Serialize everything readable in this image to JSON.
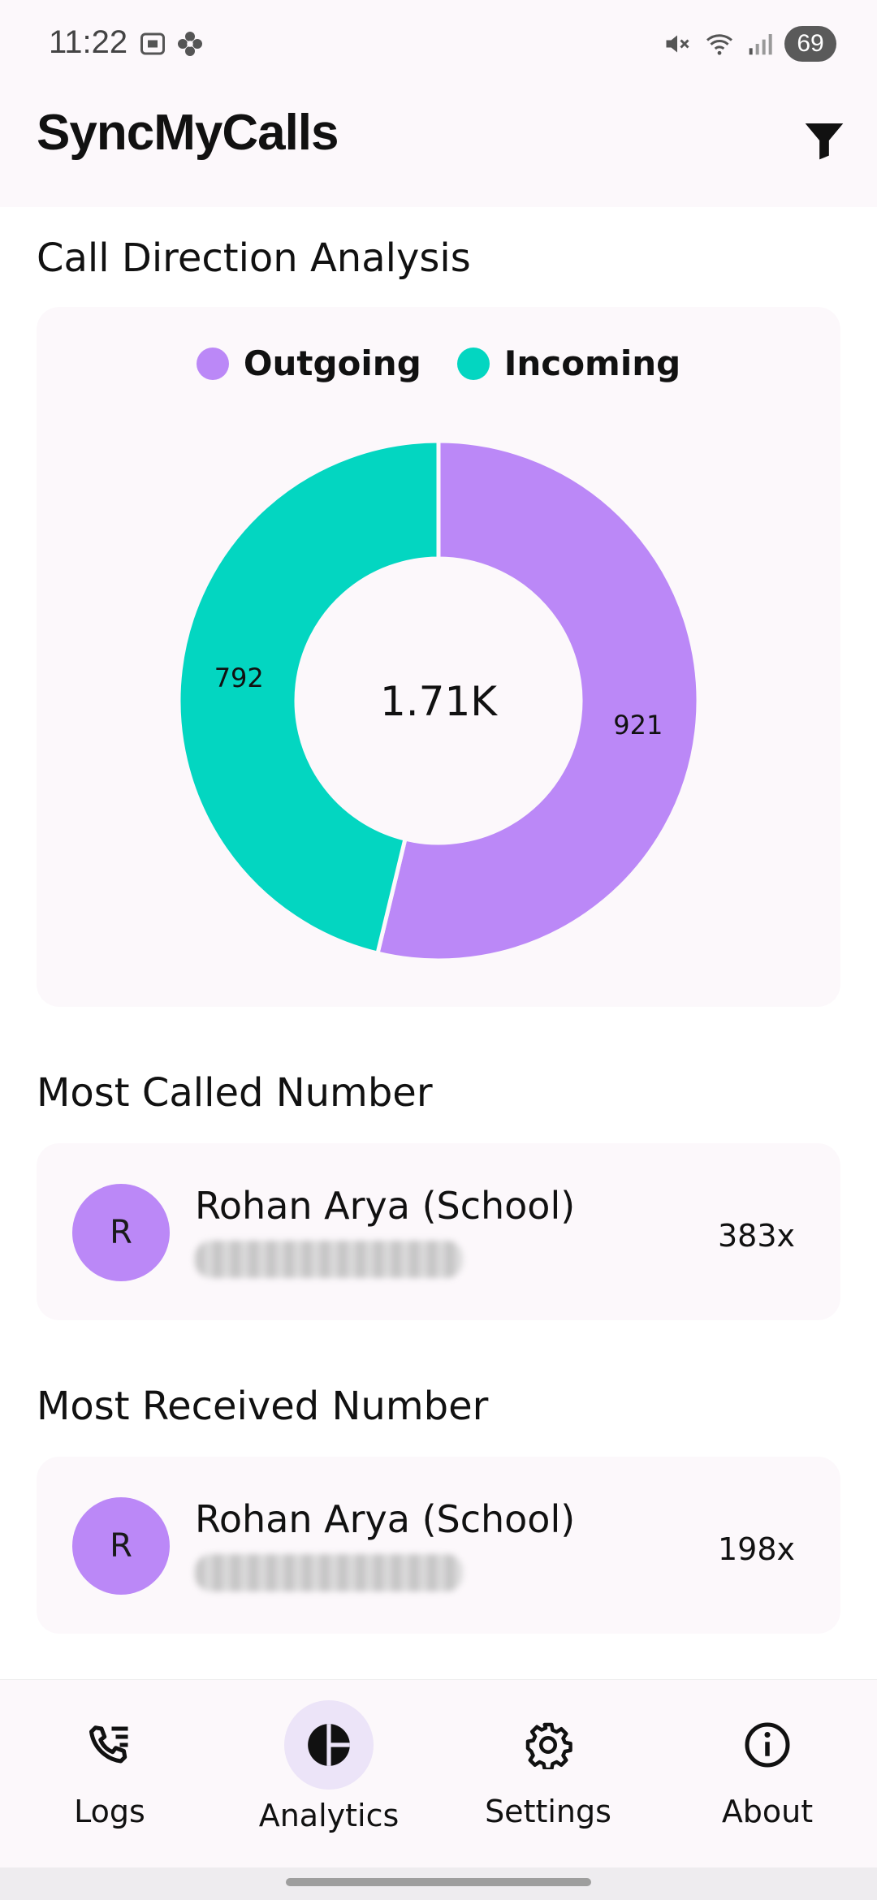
{
  "status": {
    "time": "11:22",
    "battery": "69"
  },
  "app": {
    "title": "SyncMyCalls",
    "filter_icon": "filter-icon"
  },
  "sections": {
    "direction_title": "Call Direction Analysis",
    "most_called_title": "Most Called Number",
    "most_received_title": "Most Received Number"
  },
  "chart_data": {
    "type": "pie",
    "title": "",
    "legend_placement": "top-center",
    "center_label": "1.71K",
    "slices": [
      {
        "name": "Outgoing",
        "value": 921,
        "label": "921",
        "color": "#bb88f7"
      },
      {
        "name": "Incoming",
        "value": 792,
        "label": "792",
        "color": "#03d6c1"
      }
    ]
  },
  "most_called": {
    "avatar_letter": "R",
    "name": "Rohan Arya (School)",
    "count": "383x"
  },
  "most_received": {
    "avatar_letter": "R",
    "name": "Rohan Arya (School)",
    "count": "198x"
  },
  "nav": {
    "items": [
      {
        "label": "Logs",
        "icon": "call-log-icon"
      },
      {
        "label": "Analytics",
        "icon": "pie-chart-icon",
        "active": true
      },
      {
        "label": "Settings",
        "icon": "gear-icon"
      },
      {
        "label": "About",
        "icon": "info-icon"
      }
    ]
  },
  "colors": {
    "accent": "#bb88f7",
    "teal": "#03d6c1",
    "surface": "#fcf8fb",
    "nav_active": "#ece4f8"
  }
}
